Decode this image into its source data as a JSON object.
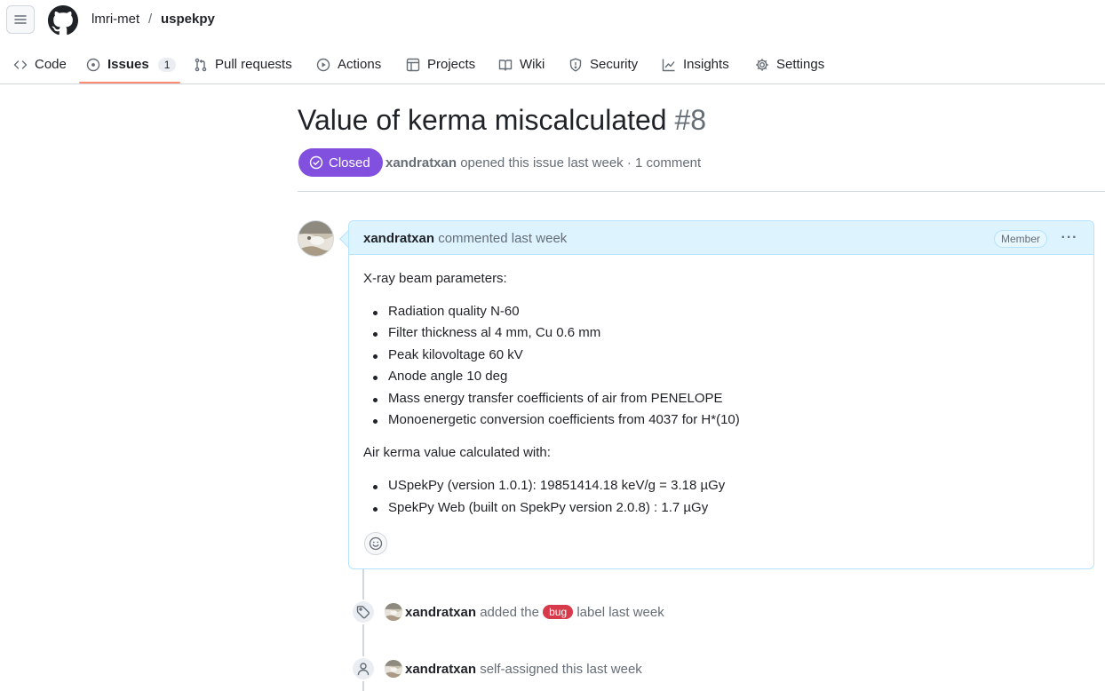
{
  "repo": {
    "owner": "lmri-met",
    "separator": "/",
    "name": "uspekpy"
  },
  "nav": {
    "tabs": [
      {
        "label": "Code",
        "icon": "code-icon"
      },
      {
        "label": "Issues",
        "icon": "issue-opened-icon",
        "counter": "1",
        "selected": true
      },
      {
        "label": "Pull requests",
        "icon": "git-pull-request-icon"
      },
      {
        "label": "Actions",
        "icon": "play-icon"
      },
      {
        "label": "Projects",
        "icon": "table-icon"
      },
      {
        "label": "Wiki",
        "icon": "book-icon"
      },
      {
        "label": "Security",
        "icon": "shield-icon"
      },
      {
        "label": "Insights",
        "icon": "graph-icon"
      },
      {
        "label": "Settings",
        "icon": "gear-icon"
      }
    ]
  },
  "issue": {
    "title": "Value of kerma miscalculated",
    "number": "#8",
    "state": "Closed",
    "author": "xandratxan",
    "meta_rest": "opened this issue last week · 1 comment"
  },
  "comment": {
    "author": "xandratxan",
    "action": "commented last week",
    "role_badge": "Member",
    "intro": "X-ray beam parameters:",
    "params": [
      "Radiation quality N-60",
      "Filter thickness al 4 mm, Cu 0.6 mm",
      "Peak kilovoltage 60 kV",
      "Anode angle 10 deg",
      "Mass energy transfer coefficients of air from PENELOPE",
      "Monoenergetic conversion coefficients from 4037 for H*(10)"
    ],
    "results_intro": "Air kerma value calculated with:",
    "results": [
      "USpekPy (version 1.0.1): 19851414.18 keV/g = 3.18 µGy",
      "SpekPy Web (built on SpekPy version 2.0.8) : 1.7 µGy"
    ]
  },
  "timeline": [
    {
      "icon": "tag-icon",
      "author": "xandratxan",
      "before": "added the",
      "label": "bug",
      "after": "label last week"
    },
    {
      "icon": "person-icon",
      "author": "xandratxan",
      "text": "self-assigned this last week"
    }
  ],
  "colors": {
    "closed_purple": "#8250df",
    "bug_red": "#d73a4a",
    "tab_underline": "#fd8c73",
    "comment_header": "#ddf4ff"
  }
}
